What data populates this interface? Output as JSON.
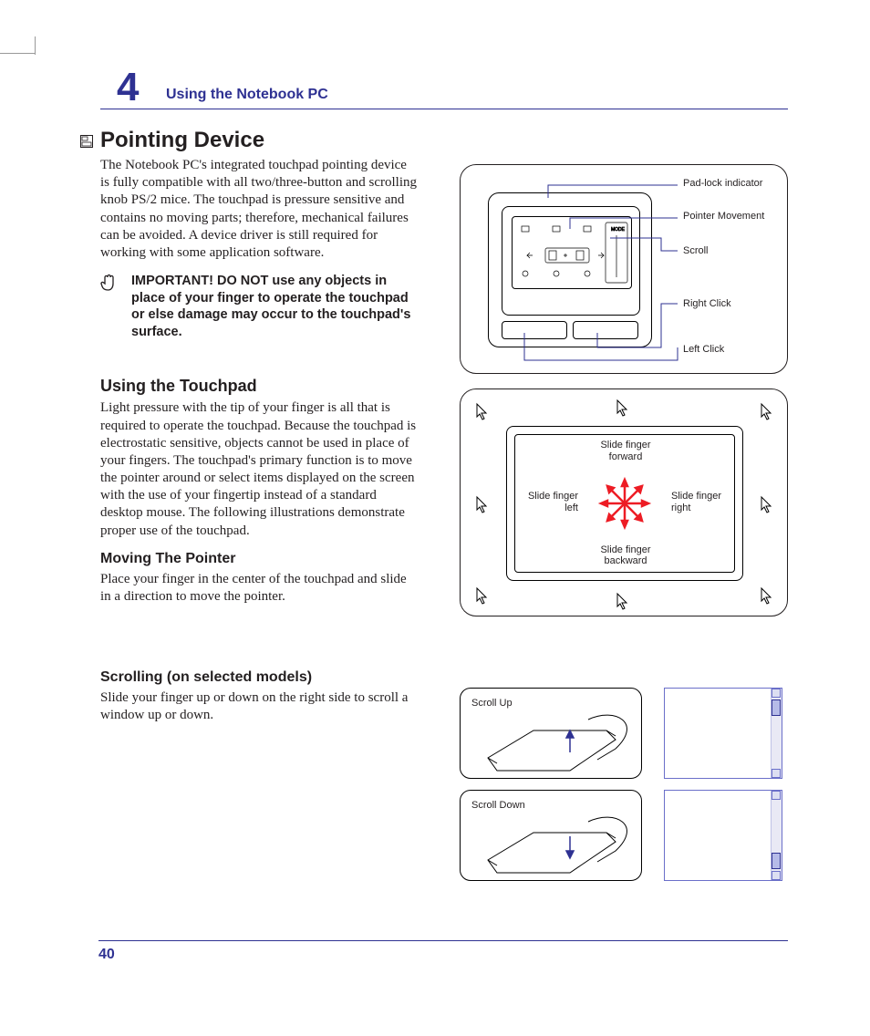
{
  "header": {
    "chapter_num": "4",
    "chapter_title": "Using the Notebook PC"
  },
  "pointing_device": {
    "title": "Pointing Device",
    "body": "The Notebook PC's integrated touchpad pointing device is fully compatible with all two/three-button and scrolling knob PS/2 mice. The touchpad is pressure sensitive and contains no moving parts; therefore, mechanical failures can be avoided. A device driver is still required for working with some application software."
  },
  "important_note": "IMPORTANT! DO NOT use any objects in place of your finger to operate the touchpad or else damage may occur to the touchpad's surface.",
  "using_touchpad": {
    "title": "Using the Touchpad",
    "body": "Light pressure with the tip of your finger is all that is required to operate the touchpad. Because the touchpad is electrostatic sensitive, objects cannot be used in place of your fingers. The touchpad's primary function is to move the pointer around or select items displayed on the screen with the use of your fingertip instead of a standard desktop mouse. The following illustrations demonstrate proper use of the touchpad."
  },
  "moving_pointer": {
    "title": "Moving The Pointer",
    "body": "Place your finger in the center of the touchpad and slide in a direction to move the pointer."
  },
  "scrolling": {
    "title": "Scrolling (on selected models)",
    "body": "Slide your finger up or down on the right side to scroll a window up or down."
  },
  "fig1_labels": {
    "padlock": "Pad-lock indicator",
    "pointer": "Pointer Movement",
    "scroll": "Scroll",
    "rightclick": "Right Click",
    "leftclick": "Left Click"
  },
  "fig2_labels": {
    "forward": "Slide finger forward",
    "left": "Slide finger left",
    "right": "Slide finger right",
    "backward": "Slide finger backward"
  },
  "scroll_labels": {
    "up": "Scroll Up",
    "down": "Scroll Down"
  },
  "page_number": "40"
}
